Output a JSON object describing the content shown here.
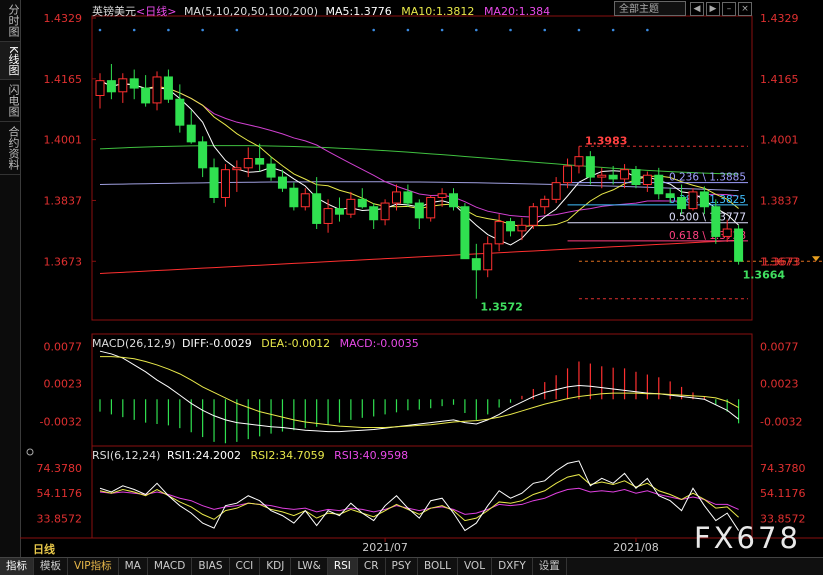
{
  "sidebar": {
    "tabs": [
      {
        "label": "分时图",
        "active": false
      },
      {
        "label": "K线图",
        "active": true
      },
      {
        "label": "闪电图",
        "active": false
      },
      {
        "label": "合约资料",
        "active": false
      }
    ]
  },
  "header": {
    "symbol": "英镑美元",
    "period": "<日线>",
    "ma_label": "MA(5,10,20,50,100,200)",
    "ma5": "MA5:1.3776",
    "ma10": "MA10:1.3812",
    "ma20": "MA20:1.384",
    "theme_select": "全部主题",
    "colors": {
      "ma5": "#ffffff",
      "ma10": "#e8e84a",
      "ma20": "#d040d0",
      "ma50": "#40c040",
      "ma100": "#a0a0e0",
      "ma200": "#ff3030"
    }
  },
  "macd_header": {
    "label": "MACD(26,12,9)",
    "diff": "DIFF:-0.0029",
    "dea": "DEA:-0.0012",
    "macd": "MACD:-0.0035"
  },
  "rsi_header": {
    "label": "RSI(6,12,24)",
    "rsi1": "RSI1:24.2002",
    "rsi2": "RSI2:34.7059",
    "rsi3": "RSI3:40.9598"
  },
  "chart_data": {
    "type": "candlestick",
    "price_axis_ticks": [
      "1.4329",
      "1.4165",
      "1.4001",
      "1.3837",
      "1.3673"
    ],
    "price_range": [
      1.352,
      1.4329
    ],
    "current_price_label": "1.3673",
    "annotations": {
      "high": "1.3983",
      "low": "1.3572",
      "last_low": "1.3664"
    },
    "fib_levels": [
      {
        "label": "0.236 \\ 1.3885",
        "value": 1.3885,
        "color": "#a0a0ff"
      },
      {
        "label": "0.382 \\ 1.3825",
        "value": 1.3825,
        "color": "#40c0ff"
      },
      {
        "label": "0.500 \\ 1.3777",
        "value": 1.3777,
        "color": "#e0e0ff"
      },
      {
        "label": "0.618 \\ 1.3728",
        "value": 1.3728,
        "color": "#ff4080"
      }
    ],
    "macd_axis_ticks": [
      "0.0077",
      "0.0023",
      "-0.0032"
    ],
    "macd_range": [
      -0.0068,
      0.0095
    ],
    "rsi_axis_ticks": [
      "74.3780",
      "54.1176",
      "33.8572"
    ],
    "rsi_range": [
      18,
      92
    ],
    "x_labels": [
      {
        "label": "2021/07",
        "index": 25
      },
      {
        "label": "2021/08",
        "index": 47
      }
    ],
    "candles": [
      [
        1.412,
        1.418,
        1.4085,
        1.416
      ],
      [
        1.416,
        1.4205,
        1.411,
        1.413
      ],
      [
        1.413,
        1.418,
        1.41,
        1.4165
      ],
      [
        1.4165,
        1.419,
        1.411,
        1.414
      ],
      [
        1.414,
        1.4175,
        1.409,
        1.41
      ],
      [
        1.41,
        1.4185,
        1.408,
        1.417
      ],
      [
        1.417,
        1.419,
        1.41,
        1.411
      ],
      [
        1.411,
        1.415,
        1.402,
        1.404
      ],
      [
        1.404,
        1.408,
        1.399,
        1.3995
      ],
      [
        1.3995,
        1.401,
        1.39,
        1.3925
      ],
      [
        1.3925,
        1.395,
        1.383,
        1.3845
      ],
      [
        1.3845,
        1.3935,
        1.382,
        1.392
      ],
      [
        1.392,
        1.3945,
        1.386,
        1.3925
      ],
      [
        1.3925,
        1.398,
        1.39,
        1.395
      ],
      [
        1.395,
        1.399,
        1.3915,
        1.3935
      ],
      [
        1.3935,
        1.3955,
        1.389,
        1.39
      ],
      [
        1.39,
        1.392,
        1.386,
        1.387
      ],
      [
        1.387,
        1.3885,
        1.381,
        1.382
      ],
      [
        1.382,
        1.387,
        1.381,
        1.3855
      ],
      [
        1.3855,
        1.39,
        1.376,
        1.3775
      ],
      [
        1.3775,
        1.384,
        1.375,
        1.3815
      ],
      [
        1.3815,
        1.3845,
        1.378,
        1.38
      ],
      [
        1.38,
        1.386,
        1.379,
        1.384
      ],
      [
        1.384,
        1.387,
        1.3815,
        1.382
      ],
      [
        1.382,
        1.383,
        1.376,
        1.3785
      ],
      [
        1.3785,
        1.384,
        1.377,
        1.383
      ],
      [
        1.383,
        1.388,
        1.381,
        1.386
      ],
      [
        1.386,
        1.388,
        1.382,
        1.383
      ],
      [
        1.383,
        1.384,
        1.376,
        1.379
      ],
      [
        1.379,
        1.385,
        1.378,
        1.3845
      ],
      [
        1.3845,
        1.387,
        1.382,
        1.3855
      ],
      [
        1.3855,
        1.387,
        1.381,
        1.382
      ],
      [
        1.382,
        1.383,
        1.3715,
        1.368
      ],
      [
        1.368,
        1.372,
        1.3572,
        1.365
      ],
      [
        1.365,
        1.374,
        1.363,
        1.372
      ],
      [
        1.372,
        1.38,
        1.37,
        1.378
      ],
      [
        1.378,
        1.379,
        1.374,
        1.3755
      ],
      [
        1.3755,
        1.379,
        1.373,
        1.377
      ],
      [
        1.377,
        1.383,
        1.376,
        1.382
      ],
      [
        1.382,
        1.385,
        1.38,
        1.384
      ],
      [
        1.384,
        1.39,
        1.383,
        1.3885
      ],
      [
        1.3885,
        1.395,
        1.387,
        1.393
      ],
      [
        1.393,
        1.3983,
        1.391,
        1.3955
      ],
      [
        1.3955,
        1.397,
        1.388,
        1.39
      ],
      [
        1.39,
        1.3925,
        1.387,
        1.3905
      ],
      [
        1.3905,
        1.393,
        1.388,
        1.3895
      ],
      [
        1.3895,
        1.3935,
        1.387,
        1.392
      ],
      [
        1.392,
        1.393,
        1.387,
        1.388
      ],
      [
        1.388,
        1.3915,
        1.386,
        1.3905
      ],
      [
        1.3905,
        1.3925,
        1.384,
        1.3855
      ],
      [
        1.3855,
        1.387,
        1.383,
        1.3845
      ],
      [
        1.3845,
        1.388,
        1.38,
        1.3815
      ],
      [
        1.3815,
        1.387,
        1.381,
        1.386
      ],
      [
        1.386,
        1.3875,
        1.38,
        1.382
      ],
      [
        1.382,
        1.384,
        1.372,
        1.374
      ],
      [
        1.374,
        1.3785,
        1.3725,
        1.376
      ],
      [
        1.376,
        1.377,
        1.3664,
        1.3673
      ]
    ],
    "macd_hist": [
      -0.0018,
      -0.0022,
      -0.0026,
      -0.003,
      -0.0034,
      -0.0036,
      -0.0038,
      -0.0042,
      -0.0048,
      -0.0055,
      -0.0062,
      -0.0064,
      -0.0062,
      -0.0058,
      -0.0054,
      -0.005,
      -0.0047,
      -0.0045,
      -0.0042,
      -0.004,
      -0.0037,
      -0.0034,
      -0.003,
      -0.0027,
      -0.0025,
      -0.0022,
      -0.0019,
      -0.0016,
      -0.0015,
      -0.0013,
      -0.001,
      -0.0008,
      -0.002,
      -0.003,
      -0.0022,
      -0.0012,
      -0.0005,
      0.0005,
      0.0015,
      0.0025,
      0.0035,
      0.0045,
      0.0055,
      0.0052,
      0.0048,
      0.0046,
      0.0045,
      0.004,
      0.0036,
      0.0032,
      0.0026,
      0.0018,
      0.001,
      0.0004,
      -0.0008,
      -0.0018,
      -0.0035
    ],
    "macd_diff": [
      0.007,
      0.0066,
      0.006,
      0.005,
      0.004,
      0.0028,
      0.0018,
      0.0006,
      -0.0006,
      -0.0016,
      -0.0024,
      -0.003,
      -0.0034,
      -0.0036,
      -0.0038,
      -0.004,
      -0.0041,
      -0.0043,
      -0.0045,
      -0.0046,
      -0.0047,
      -0.0047,
      -0.0046,
      -0.0045,
      -0.0044,
      -0.0042,
      -0.004,
      -0.0038,
      -0.0036,
      -0.0034,
      -0.0032,
      -0.003,
      -0.0034,
      -0.0036,
      -0.003,
      -0.0022,
      -0.0012,
      -0.0004,
      0.0004,
      0.001,
      0.0014,
      0.0018,
      0.002,
      0.0019,
      0.0017,
      0.0015,
      0.0013,
      0.0011,
      0.0009,
      0.0008,
      0.0006,
      0.0004,
      0.0002,
      0.0,
      -0.0008,
      -0.0016,
      -0.0029
    ],
    "macd_dea": [
      0.0062,
      0.0062,
      0.0061,
      0.0059,
      0.0055,
      0.005,
      0.0044,
      0.0037,
      0.0028,
      0.0018,
      0.001,
      0.0002,
      -0.0006,
      -0.0012,
      -0.0018,
      -0.0022,
      -0.0026,
      -0.003,
      -0.0033,
      -0.0035,
      -0.0037,
      -0.0039,
      -0.004,
      -0.0041,
      -0.0041,
      -0.0041,
      -0.004,
      -0.0039,
      -0.0038,
      -0.0037,
      -0.0035,
      -0.0033,
      -0.0032,
      -0.0031,
      -0.0029,
      -0.0026,
      -0.0022,
      -0.0017,
      -0.0012,
      -0.0007,
      -0.0003,
      0.0001,
      0.0004,
      0.0006,
      0.0008,
      0.0009,
      0.0009,
      0.0009,
      0.0008,
      0.0008,
      0.0007,
      0.0006,
      0.0005,
      0.0004,
      0.0002,
      -0.0003,
      -0.0012
    ],
    "rsi1": [
      58,
      55,
      60,
      57,
      53,
      62,
      52,
      44,
      38,
      30,
      26,
      44,
      46,
      52,
      48,
      40,
      36,
      30,
      40,
      28,
      40,
      36,
      46,
      38,
      32,
      44,
      52,
      42,
      34,
      48,
      50,
      38,
      24,
      30,
      44,
      56,
      50,
      54,
      62,
      64,
      72,
      78,
      80,
      60,
      66,
      62,
      70,
      58,
      66,
      52,
      48,
      40,
      58,
      44,
      32,
      38,
      24
    ],
    "rsi2": [
      56,
      54,
      57,
      55,
      52,
      57,
      52,
      47,
      43,
      37,
      33,
      40,
      42,
      46,
      45,
      41,
      39,
      36,
      40,
      34,
      38,
      37,
      41,
      38,
      35,
      40,
      45,
      41,
      37,
      42,
      44,
      40,
      32,
      34,
      40,
      47,
      46,
      48,
      53,
      56,
      62,
      67,
      69,
      61,
      63,
      61,
      64,
      59,
      62,
      56,
      53,
      49,
      54,
      49,
      42,
      43,
      34.7
    ],
    "rsi3": [
      55,
      54,
      55,
      54,
      53,
      55,
      53,
      50,
      48,
      44,
      41,
      43,
      44,
      46,
      45,
      44,
      42,
      41,
      42,
      39,
      41,
      40,
      42,
      41,
      39,
      41,
      44,
      42,
      40,
      42,
      43,
      41,
      37,
      38,
      41,
      45,
      44,
      45,
      48,
      50,
      54,
      57,
      58,
      55,
      56,
      55,
      57,
      54,
      56,
      53,
      51,
      49,
      51,
      49,
      45,
      45,
      41
    ]
  },
  "bottom_bar": {
    "period_label": "日线",
    "tabs": [
      {
        "label": "指标",
        "active": true,
        "vip": false
      },
      {
        "label": "模板",
        "active": false,
        "vip": false
      },
      {
        "label": "VIP指标",
        "active": false,
        "vip": true
      },
      {
        "label": "MA",
        "active": false,
        "vip": false
      },
      {
        "label": "MACD",
        "active": false,
        "vip": false
      },
      {
        "label": "BIAS",
        "active": false,
        "vip": false
      },
      {
        "label": "CCI",
        "active": false,
        "vip": false
      },
      {
        "label": "KDJ",
        "active": false,
        "vip": false
      },
      {
        "label": "LW&",
        "active": false,
        "vip": false
      },
      {
        "label": "RSI",
        "active": true,
        "vip": false
      },
      {
        "label": "CR",
        "active": false,
        "vip": false
      },
      {
        "label": "PSY",
        "active": false,
        "vip": false
      },
      {
        "label": "BOLL",
        "active": false,
        "vip": false
      },
      {
        "label": "VOL",
        "active": false,
        "vip": false
      },
      {
        "label": "DXFY",
        "active": false,
        "vip": false
      },
      {
        "label": "设置",
        "active": false,
        "vip": false
      }
    ]
  },
  "watermark": "FX678"
}
